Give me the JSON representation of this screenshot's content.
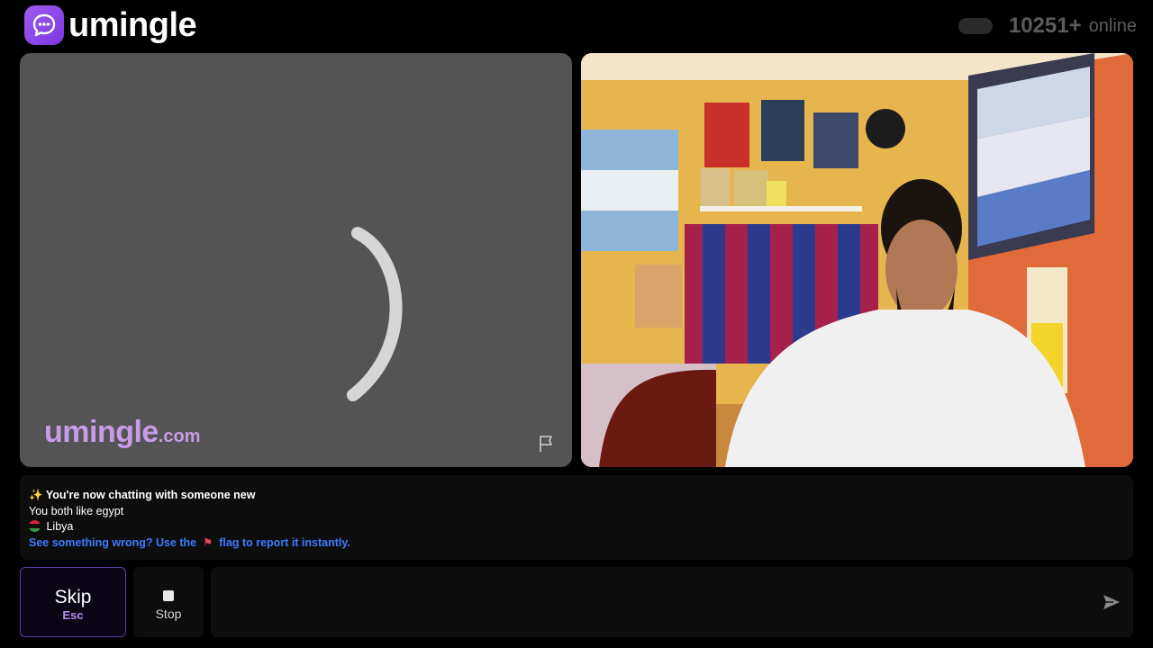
{
  "header": {
    "brand": "umingle",
    "online_count": "10251+",
    "online_label": "online"
  },
  "left_panel": {
    "watermark_main": "umingle",
    "watermark_suffix": ".com",
    "report_icon": "flag-outline-icon"
  },
  "chat_log": {
    "line1_icon": "sparkles",
    "line1": "You're now chatting with someone new",
    "line2": "You both like egypt",
    "line3_icon": "libya-flag-icon",
    "line3": "Libya",
    "report_prefix": "See something wrong? Use the",
    "report_suffix": "flag to report it instantly."
  },
  "controls": {
    "skip_label": "Skip",
    "skip_key": "Esc",
    "stop_label": "Stop",
    "message_placeholder": "",
    "send_icon": "send-arrow-icon"
  },
  "colors": {
    "brand": "#8e4ff0",
    "watermark": "#c89be8",
    "link": "#3d7bff",
    "skip_border": "#5a3aa6"
  }
}
